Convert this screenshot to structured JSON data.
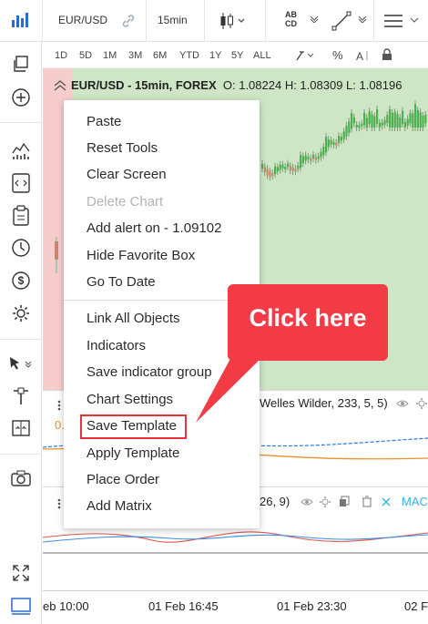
{
  "toolbar": {
    "symbol": "EUR/USD",
    "interval": "15min",
    "compare_label_top": "AB",
    "compare_label_bottom": "CD"
  },
  "ranges": [
    "1D",
    "5D",
    "1M",
    "3M",
    "6M",
    "YTD",
    "1Y",
    "5Y",
    "ALL"
  ],
  "chart": {
    "title": "EUR/USD - 15min, FOREX",
    "ohlc": "O: 1.08224 H: 1.08309 L: 1.08196"
  },
  "indicator1": {
    "label": "Welles Wilder, 233, 5, 5)",
    "value_partial": "0."
  },
  "indicator2": {
    "label": "26, 9)",
    "name_partial": "MAC"
  },
  "xaxis": {
    "labels": [
      "eb 10:00",
      "01 Feb 16:45",
      "01 Feb 23:30",
      "02 F"
    ]
  },
  "menu": {
    "items": [
      {
        "label": "Paste"
      },
      {
        "label": "Reset Tools"
      },
      {
        "label": "Clear Screen"
      },
      {
        "label": "Delete Chart",
        "disabled": true
      },
      {
        "label": "Add alert on - 1.09102"
      },
      {
        "label": "Hide Favorite Box"
      },
      {
        "label": "Go To Date"
      },
      {
        "label": "Link All Objects"
      },
      {
        "label": "Indicators"
      },
      {
        "label": "Save indicator group"
      },
      {
        "label": "Chart Settings"
      },
      {
        "label": "Save Template"
      },
      {
        "label": "Apply Template"
      },
      {
        "label": "Place Order"
      },
      {
        "label": "Add Matrix"
      }
    ]
  },
  "callout": {
    "text": "Click here"
  },
  "colors": {
    "accent": "#2a6bd4",
    "callout": "#f23b44",
    "chart_bg": "#cfe6c6",
    "pink": "#f6cccc",
    "candle_up": "#4caf50",
    "candle_down": "#c8876a"
  }
}
